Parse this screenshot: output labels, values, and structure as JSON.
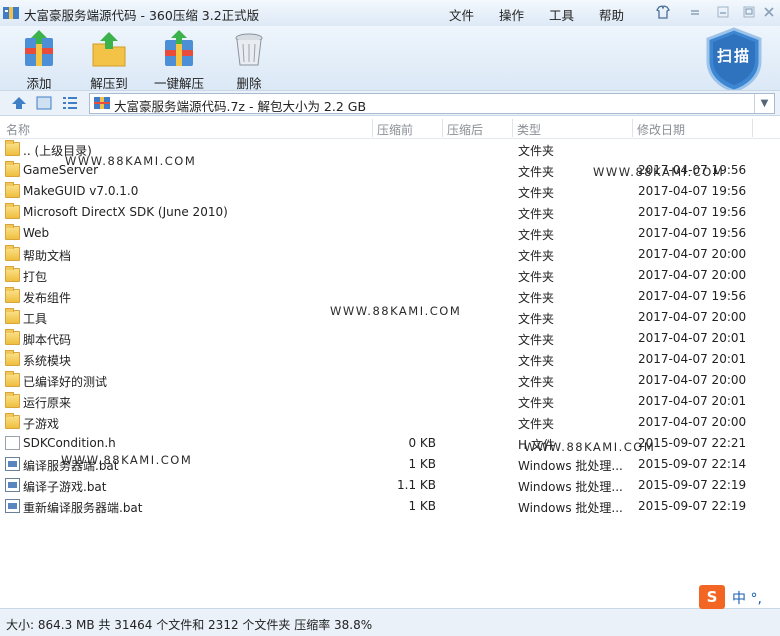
{
  "window": {
    "title": "大富豪服务端源代码 - 360压缩 3.2正式版",
    "menu": [
      "文件",
      "操作",
      "工具",
      "帮助"
    ]
  },
  "toolbar": {
    "add": "添加",
    "extract_to": "解压到",
    "one_click_extract": "一键解压",
    "delete": "删除",
    "scan": "扫描"
  },
  "address": {
    "path": "大富豪服务端源代码.7z - 解包大小为 2.2 GB"
  },
  "columns": {
    "name": "名称",
    "before": "压缩前",
    "after": "压缩后",
    "type": "类型",
    "date": "修改日期"
  },
  "files": [
    {
      "icon": "folder-icon",
      "name": ".. (上级目录)",
      "size": "",
      "type": "文件夹",
      "date": ""
    },
    {
      "icon": "folder-icon",
      "name": "GameServer",
      "size": "",
      "type": "文件夹",
      "date": "2017-04-07 19:56"
    },
    {
      "icon": "folder-icon",
      "name": "MakeGUID v7.0.1.0",
      "size": "",
      "type": "文件夹",
      "date": "2017-04-07 19:56"
    },
    {
      "icon": "folder-icon",
      "name": "Microsoft DirectX SDK (June 2010)",
      "size": "",
      "type": "文件夹",
      "date": "2017-04-07 19:56"
    },
    {
      "icon": "folder-icon",
      "name": "Web",
      "size": "",
      "type": "文件夹",
      "date": "2017-04-07 19:56"
    },
    {
      "icon": "folder-icon",
      "name": "帮助文档",
      "size": "",
      "type": "文件夹",
      "date": "2017-04-07 20:00"
    },
    {
      "icon": "folder-icon",
      "name": "打包",
      "size": "",
      "type": "文件夹",
      "date": "2017-04-07 20:00"
    },
    {
      "icon": "folder-icon",
      "name": "发布组件",
      "size": "",
      "type": "文件夹",
      "date": "2017-04-07 19:56"
    },
    {
      "icon": "folder-icon",
      "name": "工具",
      "size": "",
      "type": "文件夹",
      "date": "2017-04-07 20:00"
    },
    {
      "icon": "folder-icon",
      "name": "脚本代码",
      "size": "",
      "type": "文件夹",
      "date": "2017-04-07 20:01"
    },
    {
      "icon": "folder-icon",
      "name": "系统模块",
      "size": "",
      "type": "文件夹",
      "date": "2017-04-07 20:01"
    },
    {
      "icon": "folder-icon",
      "name": "已编译好的测试",
      "size": "",
      "type": "文件夹",
      "date": "2017-04-07 20:00"
    },
    {
      "icon": "folder-icon",
      "name": "运行原来",
      "size": "",
      "type": "文件夹",
      "date": "2017-04-07 20:01"
    },
    {
      "icon": "folder-icon",
      "name": "子游戏",
      "size": "",
      "type": "文件夹",
      "date": "2017-04-07 20:00"
    },
    {
      "icon": "file-icon",
      "name": "SDKCondition.h",
      "size": "0 KB",
      "type": "H 文件",
      "date": "2015-09-07 22:21"
    },
    {
      "icon": "batch-file-icon",
      "name": "编译服务器端.bat",
      "size": "1 KB",
      "type": "Windows 批处理...",
      "date": "2015-09-07 22:14"
    },
    {
      "icon": "batch-file-icon",
      "name": "编译子游戏.bat",
      "size": "1.1 KB",
      "type": "Windows 批处理...",
      "date": "2015-09-07 22:19"
    },
    {
      "icon": "batch-file-icon",
      "name": "重新编译服务器端.bat",
      "size": "1 KB",
      "type": "Windows 批处理...",
      "date": "2015-09-07 22:19"
    }
  ],
  "watermark": "WWW.88KAMI.COM",
  "status": "大小: 864.3 MB 共 31464 个文件和 2312 个文件夹 压缩率 38.8%",
  "ime": {
    "logo": "S",
    "text": "中 °,"
  }
}
